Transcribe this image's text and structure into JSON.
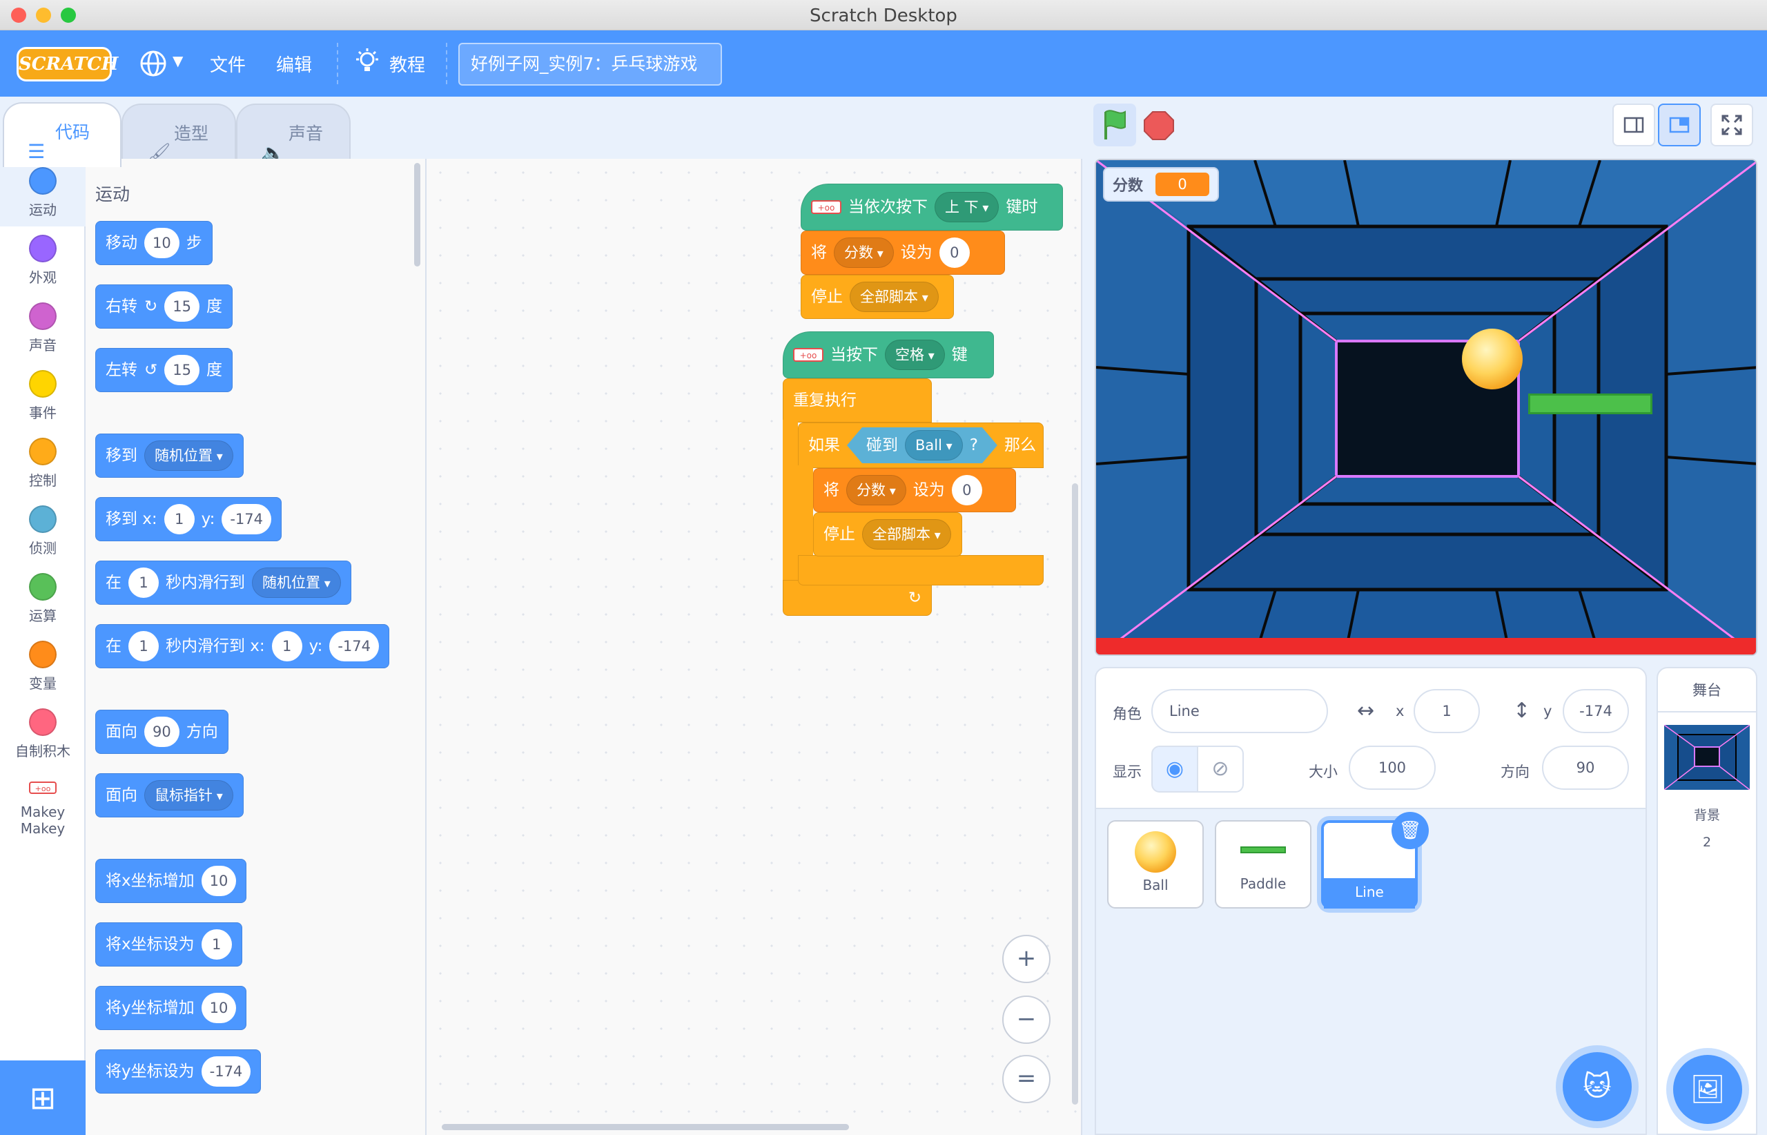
{
  "window": {
    "title": "Scratch Desktop"
  },
  "menu": {
    "logo": "SCRATCH",
    "file": "文件",
    "edit": "编辑",
    "tutorials": "教程",
    "project_title": "好例子网_实例7：乒乓球游戏"
  },
  "tabs": {
    "code": "代码",
    "costumes": "造型",
    "sounds": "声音"
  },
  "categories": [
    "运动",
    "外观",
    "声音",
    "事件",
    "控制",
    "侦测",
    "运算",
    "变量",
    "自制积木",
    "Makey Makey"
  ],
  "category_colors": [
    "#4c97ff",
    "#9966ff",
    "#cf63cf",
    "#ffd500",
    "#ffab19",
    "#5cb1d6",
    "#59c059",
    "#ff8c1a",
    "#ff6680",
    "#ffffff"
  ],
  "palette": {
    "heading": "运动",
    "b1": {
      "a": "移动",
      "v": "10",
      "b": "步"
    },
    "b2": {
      "a": "右转",
      "v": "15",
      "b": "度"
    },
    "b3": {
      "a": "左转",
      "v": "15",
      "b": "度"
    },
    "b4": {
      "a": "移到",
      "d": "随机位置"
    },
    "b5": {
      "a": "移到 x:",
      "x": "1",
      "y_label": "y:",
      "y": "-174"
    },
    "b6": {
      "a": "在",
      "v": "1",
      "b": "秒内滑行到",
      "d": "随机位置"
    },
    "b7": {
      "a": "在",
      "v": "1",
      "b": "秒内滑行到 x:",
      "x": "1",
      "y_label": "y:",
      "y": "-174"
    },
    "b8": {
      "a": "面向",
      "v": "90",
      "b": "方向"
    },
    "b9": {
      "a": "面向",
      "d": "鼠标指针"
    },
    "b10": {
      "a": "将x坐标增加",
      "v": "10"
    },
    "b11": {
      "a": "将x坐标设为",
      "v": "1"
    },
    "b12": {
      "a": "将y坐标增加",
      "v": "10"
    },
    "b13": {
      "a": "将y坐标设为",
      "v": "-174"
    }
  },
  "script1": {
    "hat_a": "当依次按下",
    "hat_d": "上 下",
    "hat_b": "键时",
    "set_a": "将",
    "set_d": "分数",
    "set_b": "设为",
    "set_v": "0",
    "stop_a": "停止",
    "stop_d": "全部脚本"
  },
  "script2": {
    "hat_a": "当按下",
    "hat_d": "空格",
    "hat_b": "键",
    "forever": "重复执行",
    "if_a": "如果",
    "touch_a": "碰到",
    "touch_d": "Ball",
    "touch_q": "?",
    "if_b": "那么",
    "set_a": "将",
    "set_d": "分数",
    "set_b": "设为",
    "set_v": "0",
    "stop_a": "停止",
    "stop_d": "全部脚本"
  },
  "zoom": {
    "in": "+",
    "out": "−",
    "reset": "="
  },
  "stage": {
    "monitor_label": "分数",
    "monitor_value": "0"
  },
  "sprite_info": {
    "sprite_label": "角色",
    "sprite_name": "Line",
    "x_label": "x",
    "x": "1",
    "y_label": "y",
    "y": "-174",
    "show_label": "显示",
    "size_label": "大小",
    "size": "100",
    "direction_label": "方向",
    "direction": "90"
  },
  "sprites": [
    "Ball",
    "Paddle",
    "Line"
  ],
  "stage_panel": {
    "title": "舞台",
    "backdrops_label": "背景",
    "backdrops_count": "2"
  }
}
